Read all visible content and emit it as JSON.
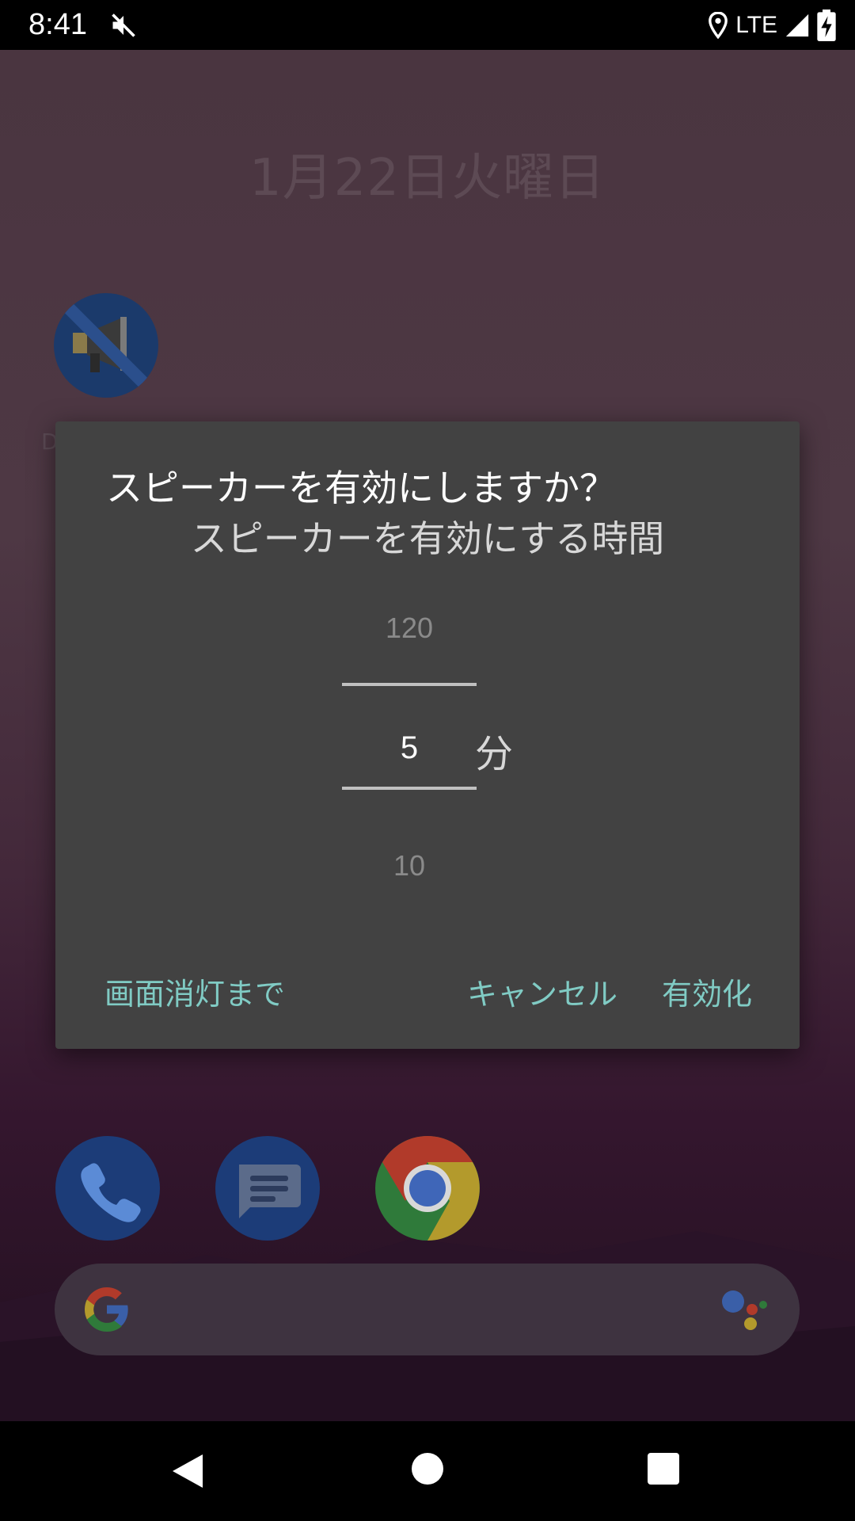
{
  "status_bar": {
    "time": "8:41",
    "network": "LTE",
    "icons": [
      "mute-icon",
      "location-icon",
      "signal-icon",
      "battery-charging-icon"
    ]
  },
  "home": {
    "date": "1月22日火曜日",
    "app_label_stub": "D",
    "dock_icons": [
      "phone-icon",
      "messages-icon",
      "chrome-icon"
    ],
    "search_icons": [
      "google-g-icon",
      "assistant-icon"
    ]
  },
  "dialog": {
    "title": "スピーカーを有効にしますか？",
    "subtitle": "スピーカーを有効にする時間",
    "picker": {
      "previous": "120",
      "current": "5",
      "next": "10",
      "unit": "分"
    },
    "buttons": {
      "screen_off": "画面消灯まで",
      "cancel": "キャンセル",
      "enable": "有効化"
    },
    "accent_color": "#80cbc4"
  },
  "nav": {
    "icons": [
      "back-icon",
      "home-icon",
      "recents-icon"
    ]
  }
}
